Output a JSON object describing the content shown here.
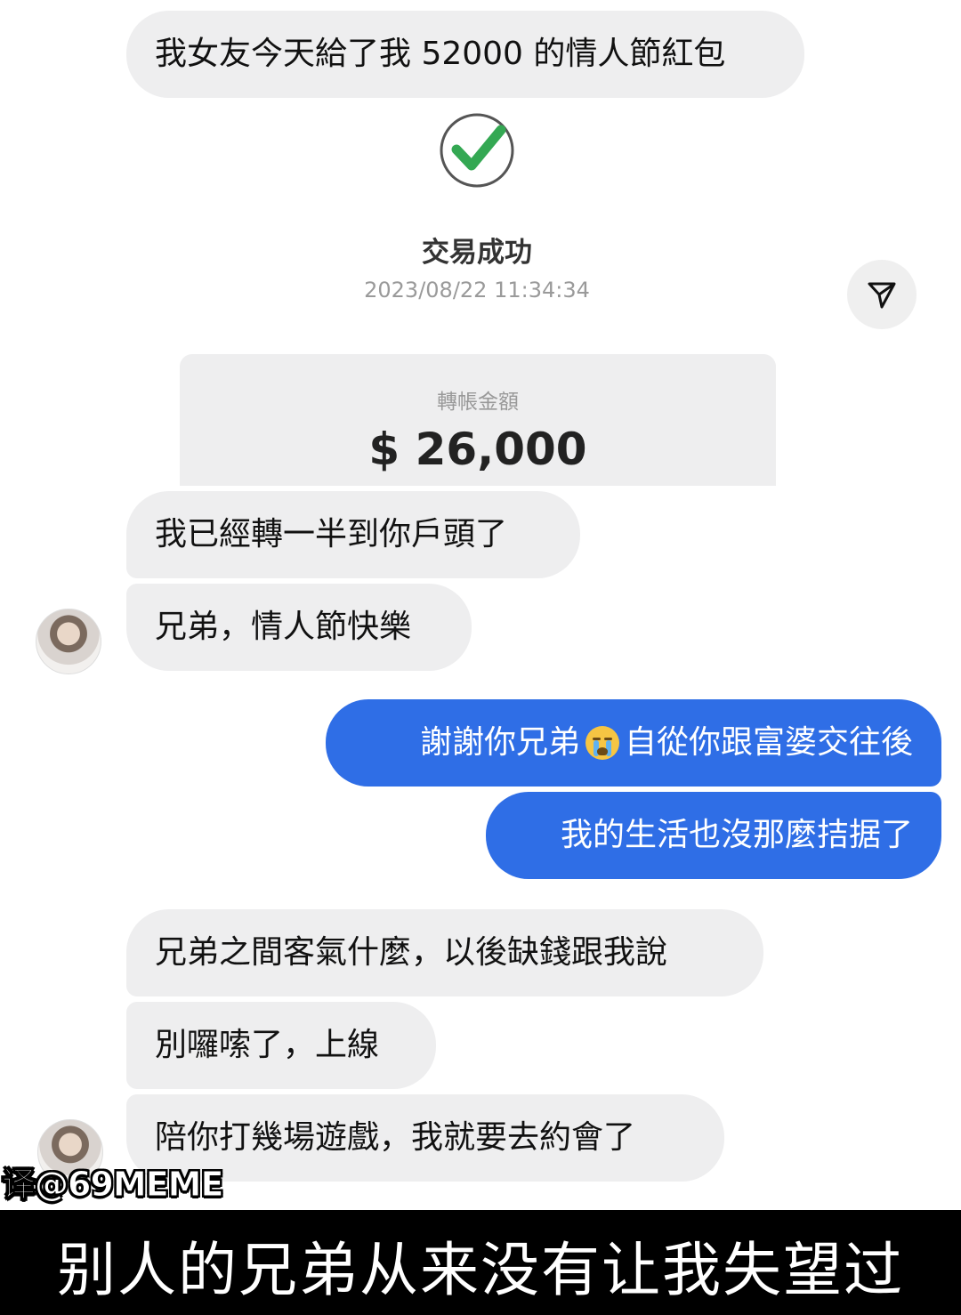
{
  "messages": {
    "m1": "我女友今天給了我 52000 的情人節紅包",
    "m2": "我已經轉一半到你戶頭了",
    "m3": "兄弟，情人節快樂",
    "m4_a": "謝謝你兄弟",
    "m4_b": "自從你跟富婆交往後",
    "m5": "我的生活也沒那麼拮据了",
    "m6": "兄弟之間客氣什麼，以後缺錢跟我說",
    "m7": "別囉嗦了，上線",
    "m8": "陪你打幾場遊戲，我就要去約會了"
  },
  "transaction": {
    "status": "交易成功",
    "datetime": "2023/08/22 11:34:34",
    "amount_label": "轉帳金額",
    "amount": "$ 26,000"
  },
  "icons": {
    "status": "check-icon",
    "share": "send-icon",
    "emoji": "crying-face-icon"
  },
  "colors": {
    "outgoing_bubble": "#2f6ee6",
    "incoming_bubble": "#eeeeef",
    "check_green": "#34a853"
  },
  "watermark": "译@69MEME",
  "caption": "别人的兄弟从来没有让我失望过"
}
